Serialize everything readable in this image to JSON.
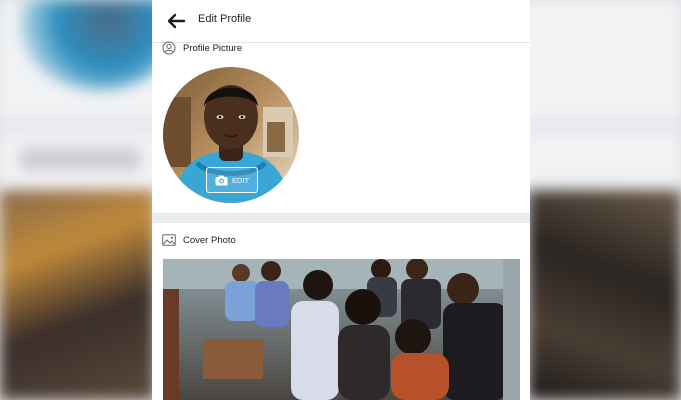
{
  "header": {
    "title": "Edit Profile",
    "back_icon": "arrow-left-icon"
  },
  "profile_picture": {
    "label": "Profile Picture",
    "icon": "user-circle-icon",
    "edit_label": "EDIT",
    "edit_icon": "camera-icon"
  },
  "cover_photo": {
    "label": "Cover Photo",
    "icon": "image-icon"
  },
  "colors": {
    "text": "#1c1e21",
    "divider": "#e9ebee",
    "panel": "#ffffff"
  }
}
